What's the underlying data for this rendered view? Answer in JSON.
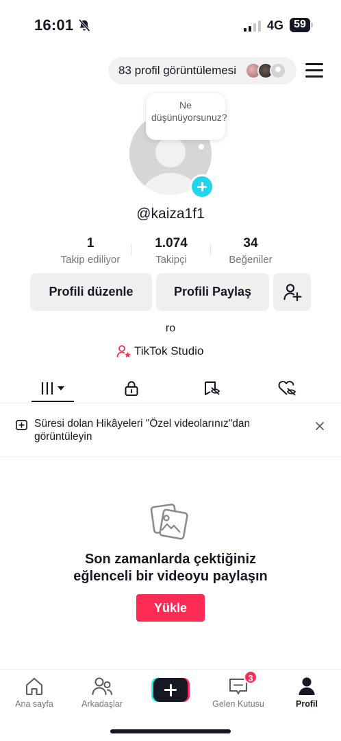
{
  "status_bar": {
    "time": "16:01",
    "network": "4G",
    "battery": "59",
    "icons": [
      "bell-slash-icon",
      "signal-icon",
      "battery-icon"
    ]
  },
  "header": {
    "profile_views": "83 profil görüntülemesi",
    "menu_icon": "hamburger-menu-icon"
  },
  "avatar": {
    "bubble_text": "Ne düşünüyorsunuz?",
    "add_icon": "plus-icon"
  },
  "profile": {
    "username": "@kaiza1f1",
    "bio": "ro",
    "studio_label": "TikTok Studio"
  },
  "stats": {
    "following": {
      "value": "1",
      "label": "Takip ediliyor"
    },
    "followers": {
      "value": "1.074",
      "label": "Takipçi"
    },
    "likes": {
      "value": "34",
      "label": "Beğeniler"
    }
  },
  "actions": {
    "edit_label": "Profili düzenle",
    "share_label": "Profili Paylaş",
    "add_friend_icon": "add-user-icon"
  },
  "tabs": [
    {
      "icon": "grid-icon",
      "active": true
    },
    {
      "icon": "lock-icon",
      "active": false
    },
    {
      "icon": "repost-icon",
      "active": false
    },
    {
      "icon": "liked-icon",
      "active": false
    }
  ],
  "banner": {
    "text": "Süresi dolan Hikâyeleri \"Özel videolarınız\"dan görüntüleyin"
  },
  "empty_state": {
    "title_line1": "Son zamanlarda çektiğiniz",
    "title_line2": "eğlenceli bir videoyu paylaşın",
    "upload_label": "Yükle"
  },
  "bottom_nav": {
    "home": "Ana sayfa",
    "friends": "Arkadaşlar",
    "inbox": "Gelen Kutusu",
    "inbox_badge": "3",
    "profile": "Profil",
    "active": "profile"
  },
  "colors": {
    "accent_red": "#fe2c55",
    "accent_cyan": "#20d5ec",
    "text": "#161823",
    "secondary_text": "#75767c",
    "button_bg": "#efeff0"
  }
}
